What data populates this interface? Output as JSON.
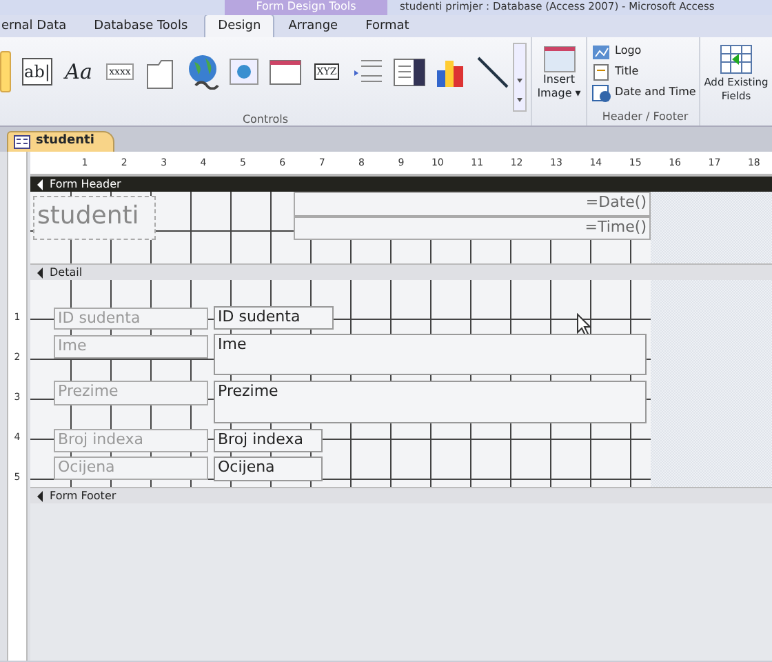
{
  "window": {
    "title": "studenti primjer : Database (Access 2007) - Microsoft Access",
    "context_title": "Form Design Tools"
  },
  "ribbon_tabs": [
    {
      "label": "ernal Data",
      "selected": false
    },
    {
      "label": "Database Tools",
      "selected": false
    },
    {
      "label": "Design",
      "selected": true
    },
    {
      "label": "Arrange",
      "selected": false
    },
    {
      "label": "Format",
      "selected": false
    }
  ],
  "controls_group": {
    "label": "Controls",
    "tools": [
      {
        "kind": "pointer",
        "selected": true
      },
      {
        "kind": "glyph",
        "glyph": "ab|",
        "selected": false
      },
      {
        "kind": "glyph",
        "glyph": "Aa",
        "selected": false
      },
      {
        "kind": "glyph",
        "glyph": "xxxx",
        "selected": false
      },
      {
        "kind": "tab",
        "selected": false
      },
      {
        "kind": "globe",
        "selected": false
      },
      {
        "kind": "image",
        "selected": false
      },
      {
        "kind": "frame",
        "selected": false
      },
      {
        "kind": "glyph",
        "glyph": "XYZ",
        "selected": false
      },
      {
        "kind": "list",
        "selected": false
      },
      {
        "kind": "combo",
        "selected": false
      },
      {
        "kind": "chart",
        "selected": false
      },
      {
        "kind": "line",
        "selected": false
      }
    ]
  },
  "insert_image": {
    "label": "Insert Image",
    "caret": "▾"
  },
  "header_footer_group": {
    "label": "Header / Footer",
    "items": [
      "Logo",
      "Title",
      "Date and Time"
    ]
  },
  "add_existing_fields": {
    "label": "Add Existing Fields"
  },
  "document_tab": {
    "label": "studenti",
    "selected": true
  },
  "ruler": {
    "marks": [
      "1",
      "2",
      "3",
      "4",
      "5",
      "6",
      "7",
      "8",
      "9",
      "10",
      "11",
      "12",
      "13",
      "14",
      "15",
      "16",
      "17",
      "18"
    ]
  },
  "sections": [
    {
      "title": "Form Header",
      "selected": true,
      "controls": [
        {
          "kind": "title",
          "text": "studenti"
        },
        {
          "kind": "expr",
          "text": "=Date()"
        },
        {
          "kind": "expr",
          "text": "=Time()"
        }
      ]
    },
    {
      "title": "Detail",
      "selected": false,
      "ruler_marks": [
        "1",
        "2",
        "3",
        "4",
        "5"
      ],
      "controls": [
        {
          "kind": "label",
          "text": "ID sudenta"
        },
        {
          "kind": "textbox",
          "text": "ID sudenta"
        },
        {
          "kind": "label",
          "text": "Ime"
        },
        {
          "kind": "textbox",
          "text": "Ime"
        },
        {
          "kind": "label",
          "text": "Prezime"
        },
        {
          "kind": "textbox",
          "text": "Prezime"
        },
        {
          "kind": "label",
          "text": "Broj indexa"
        },
        {
          "kind": "textbox",
          "text": "Broj indexa"
        },
        {
          "kind": "label",
          "text": "Ocijena"
        },
        {
          "kind": "textbox",
          "text": "Ocijena"
        }
      ]
    },
    {
      "title": "Form Footer",
      "selected": false
    }
  ]
}
